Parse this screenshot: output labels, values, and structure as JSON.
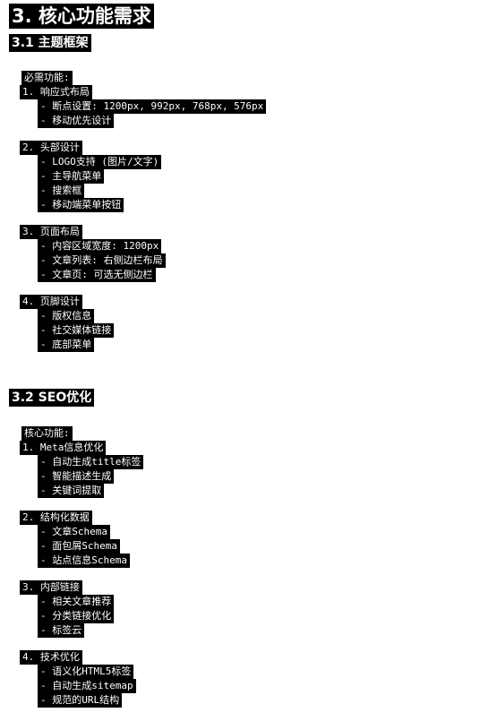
{
  "title": "3. 核心功能需求",
  "sections": [
    {
      "heading": "3.1 主题框架",
      "intro": "必需功能:",
      "groups": [
        {
          "title": "1. 响应式布局",
          "items": [
            "- 断点设置: 1200px, 992px, 768px, 576px",
            "- 移动优先设计"
          ]
        },
        {
          "title": "2. 头部设计",
          "items": [
            "- LOGO支持 (图片/文字)",
            "- 主导航菜单",
            "- 搜索框",
            "- 移动端菜单按钮"
          ]
        },
        {
          "title": "3. 页面布局",
          "items": [
            "- 内容区域宽度: 1200px",
            "- 文章列表: 右侧边栏布局",
            "- 文章页: 可选无侧边栏"
          ]
        },
        {
          "title": "4. 页脚设计",
          "items": [
            "- 版权信息",
            "- 社交媒体链接",
            "- 底部菜单"
          ]
        }
      ]
    },
    {
      "heading": "3.2 SEO优化",
      "intro": "核心功能:",
      "groups": [
        {
          "title": "1. Meta信息优化",
          "items": [
            "- 自动生成title标签",
            "- 智能描述生成",
            "- 关键词提取"
          ]
        },
        {
          "title": "2. 结构化数据",
          "items": [
            "- 文章Schema",
            "- 面包屑Schema",
            "- 站点信息Schema"
          ]
        },
        {
          "title": "3. 内部链接",
          "items": [
            "- 相关文章推荐",
            "- 分类链接优化",
            "- 标签云"
          ]
        },
        {
          "title": "4. 技术优化",
          "items": [
            "- 语义化HTML5标签",
            "- 自动生成sitemap",
            "- 规范的URL结构"
          ]
        }
      ]
    }
  ]
}
